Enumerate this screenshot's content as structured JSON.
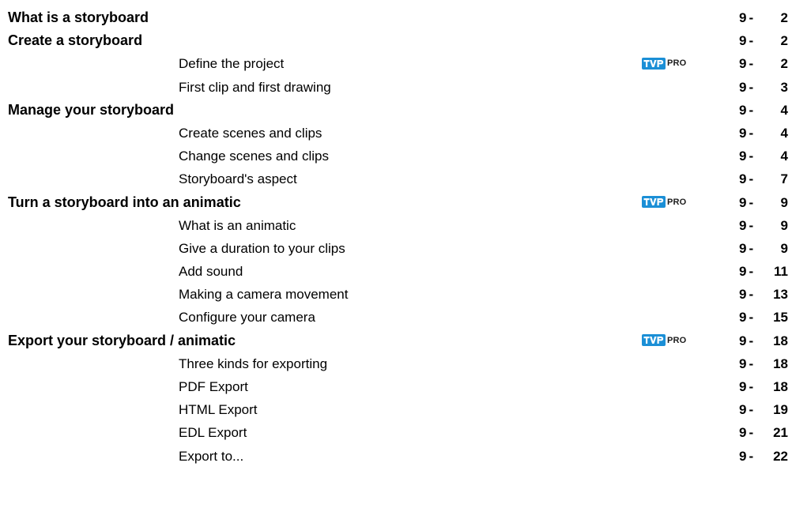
{
  "toc": [
    {
      "level": 1,
      "title": "What is a storyboard",
      "chapter": "9",
      "page": "2",
      "pro": false
    },
    {
      "level": 1,
      "title": "Create a storyboard",
      "chapter": "9",
      "page": "2",
      "pro": false
    },
    {
      "level": 2,
      "title": "Define the project",
      "chapter": "9",
      "page": "2",
      "pro": true
    },
    {
      "level": 2,
      "title": "First clip and first drawing",
      "chapter": "9",
      "page": "3",
      "pro": false
    },
    {
      "level": 1,
      "title": "Manage your storyboard",
      "chapter": "9",
      "page": "4",
      "pro": false
    },
    {
      "level": 2,
      "title": "Create scenes and clips",
      "chapter": "9",
      "page": "4",
      "pro": false
    },
    {
      "level": 2,
      "title": "Change scenes and clips",
      "chapter": "9",
      "page": "4",
      "pro": false
    },
    {
      "level": 2,
      "title": "Storyboard's aspect",
      "chapter": "9",
      "page": "7",
      "pro": false
    },
    {
      "level": 1,
      "title": "Turn a storyboard into an animatic",
      "chapter": "9",
      "page": "9",
      "pro": true
    },
    {
      "level": 2,
      "title": "What is an animatic",
      "chapter": "9",
      "page": "9",
      "pro": false
    },
    {
      "level": 2,
      "title": "Give a duration to your clips",
      "chapter": "9",
      "page": "9",
      "pro": false
    },
    {
      "level": 2,
      "title": "Add sound",
      "chapter": "9",
      "page": "11",
      "pro": false
    },
    {
      "level": 2,
      "title": "Making a camera movement",
      "chapter": "9",
      "page": "13",
      "pro": false
    },
    {
      "level": 2,
      "title": "Configure your camera",
      "chapter": "9",
      "page": "15",
      "pro": false
    },
    {
      "level": 1,
      "title": "Export your storyboard / animatic",
      "chapter": "9",
      "page": "18",
      "pro": true
    },
    {
      "level": 2,
      "title": "Three kinds for exporting",
      "chapter": "9",
      "page": "18",
      "pro": false
    },
    {
      "level": 2,
      "title": "PDF Export",
      "chapter": "9",
      "page": "18",
      "pro": false
    },
    {
      "level": 2,
      "title": "HTML Export",
      "chapter": "9",
      "page": "19",
      "pro": false
    },
    {
      "level": 2,
      "title": "EDL Export",
      "chapter": "9",
      "page": "21",
      "pro": false
    },
    {
      "level": 2,
      "title": "Export to...",
      "chapter": "9",
      "page": "22",
      "pro": false
    }
  ],
  "badge": {
    "logo": "TVP",
    "label": "PRO",
    "logo_color": "#1b8fd6",
    "icon": "tvp-logo-icon"
  },
  "separator": "-"
}
